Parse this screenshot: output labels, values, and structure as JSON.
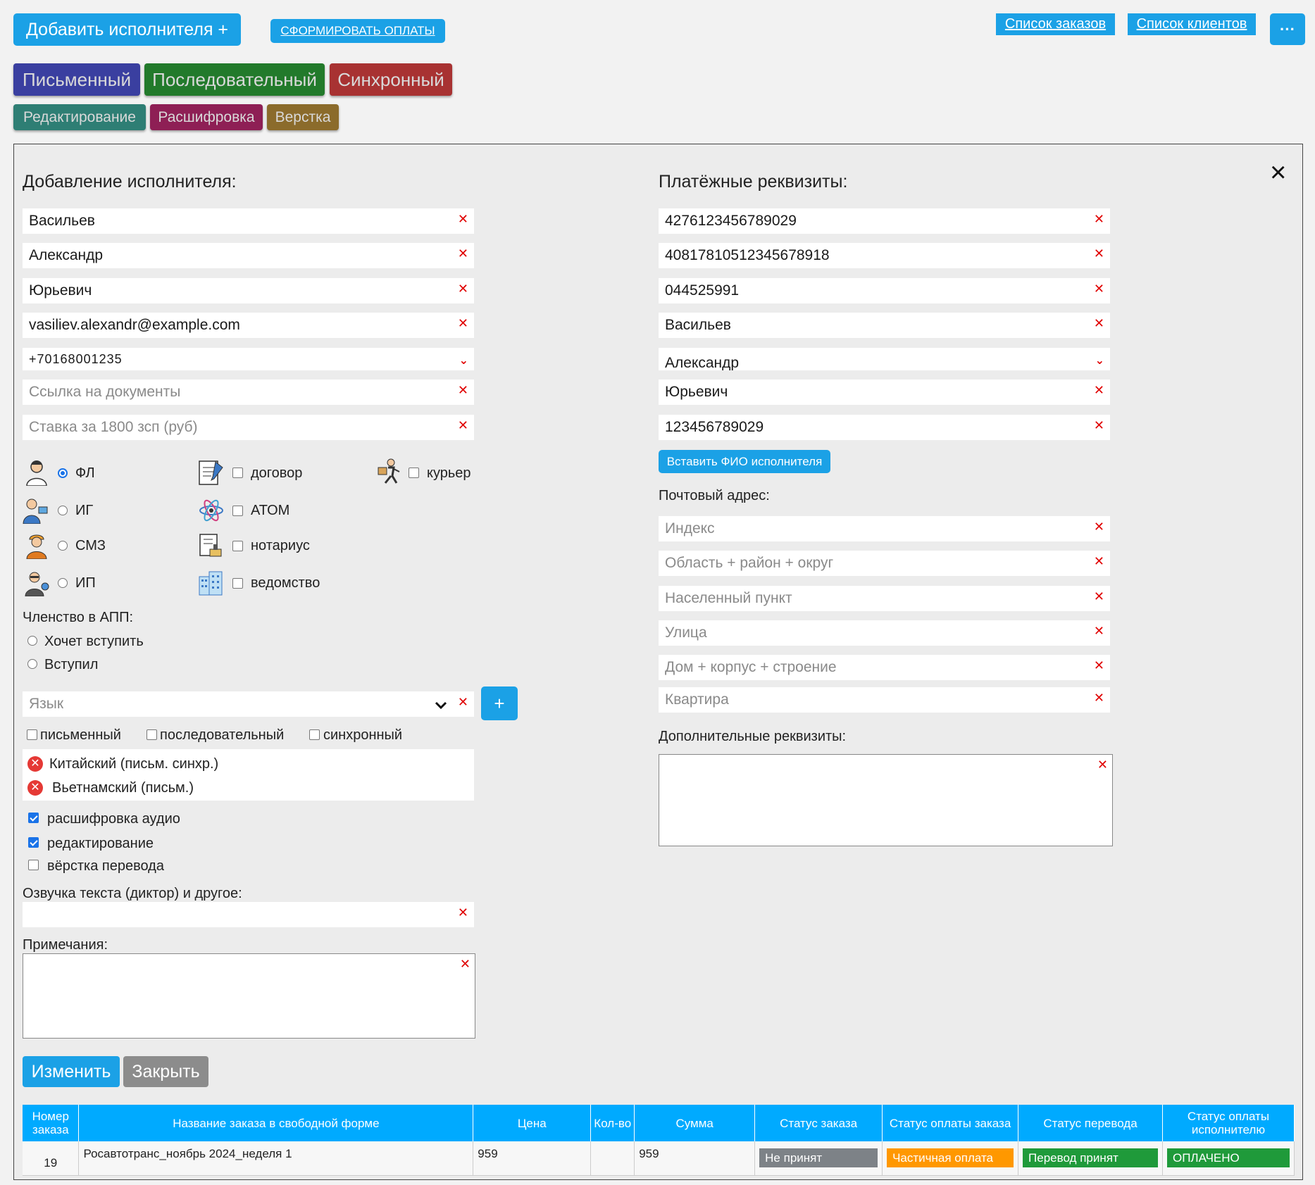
{
  "top": {
    "add_performer": "Добавить исполнителя +",
    "form_payments": "СФОРМИРОВАТЬ ОПЛАТЫ",
    "orders_list": "Список заказов",
    "clients_list": "Список клиентов",
    "more": "···"
  },
  "type_buttons": [
    {
      "label": "Письменный",
      "color": "#3a3fa0"
    },
    {
      "label": "Последовательный",
      "color": "#227a2b"
    },
    {
      "label": "Синхронный",
      "color": "#a83232"
    }
  ],
  "sub_buttons": [
    {
      "label": "Редактирование",
      "color": "#2e7e74"
    },
    {
      "label": "Расшифровка",
      "color": "#8e1f55"
    },
    {
      "label": "Верстка",
      "color": "#8b6b2b"
    }
  ],
  "left": {
    "heading": "Добавление исполнителя:",
    "fields": [
      {
        "value": "Васильев",
        "placeholder": ""
      },
      {
        "value": "Александр",
        "placeholder": ""
      },
      {
        "value": "Юрьевич",
        "placeholder": ""
      },
      {
        "value": "vasiliev.alexandr@example.com",
        "placeholder": ""
      },
      {
        "value": "+70168001235",
        "placeholder": ""
      },
      {
        "value": "",
        "placeholder": "Ссылка на документы"
      },
      {
        "value": "",
        "placeholder": "Ставка за 1800 зсп (руб)"
      }
    ],
    "status_radios": [
      "ФЛ",
      "ИГ",
      "СМЗ",
      "ИП"
    ],
    "doc_checks": [
      "договор",
      "АТОМ",
      "нотариус",
      "ведомство"
    ],
    "courier": "курьер",
    "app_label": "Членство в АПП:",
    "app_options": [
      "Хочет вступить",
      "Вступил"
    ],
    "language_placeholder": "Язык",
    "add_lang": "+",
    "mode_checks": [
      "письменный",
      "последовательный",
      "синхронный"
    ],
    "languages": [
      "Китайский (письм. синхр.)",
      "Вьетнамский (письм.)"
    ],
    "service_checks": [
      {
        "label": "расшифровка аудио",
        "checked": true
      },
      {
        "label": "редактирование",
        "checked": true
      },
      {
        "label": "вёрстка перевода",
        "checked": false
      }
    ],
    "voice_label": "Озвучка текста (диктор) и другое:",
    "notes_label": "Примечания:",
    "save": "Изменить",
    "close": "Закрыть"
  },
  "right": {
    "heading": "Платёжные реквизиты:",
    "fields": [
      {
        "value": "4276123456789029",
        "placeholder": ""
      },
      {
        "value": "40817810512345678918",
        "placeholder": ""
      },
      {
        "value": "044525991",
        "placeholder": ""
      },
      {
        "value": "Васильев",
        "placeholder": ""
      },
      {
        "value": "Александр",
        "placeholder": ""
      },
      {
        "value": "Юрьевич",
        "placeholder": ""
      },
      {
        "value": "123456789029",
        "placeholder": ""
      }
    ],
    "insert_fio": "Вставить ФИО исполнителя",
    "postal_label": "Почтовый адрес:",
    "postal_fields": [
      "Индекс",
      "Область + район + округ",
      "Населенный пункт",
      "Улица",
      "Дом + корпус + строение",
      "Квартира"
    ],
    "extra_label": "Дополнительные реквизиты:"
  },
  "close_icon": "×",
  "table": {
    "headers": [
      "Номер заказа",
      "Название заказа в свободной форме",
      "Цена",
      "Кол-во",
      "Сумма",
      "Статус заказа",
      "Статус оплаты заказа",
      "Статус перевода",
      "Статус оплаты исполнителю"
    ],
    "rows": [
      {
        "num": "19",
        "name": "Росавтотранс_ноябрь 2024_неделя 1",
        "price": "959",
        "qty": "",
        "sum": "959",
        "status": "Не принят",
        "pay_status": "Частичная оплата",
        "trans_status": "Перевод принят",
        "perf_pay": "ОПЛАЧЕНО"
      }
    ],
    "badge_colors": {
      "status": "#7d8287",
      "pay_status": "#ff9800",
      "trans_status": "#1f9a3a",
      "perf_pay": "#1f9a3a"
    }
  },
  "icons": {
    "person": "person-icon",
    "businessman": "businessman-icon",
    "worker": "worker-icon",
    "entrepreneur": "entrepreneur-icon",
    "contract": "contract-icon",
    "atom": "atom-icon",
    "notary": "notary-icon",
    "building": "building-icon",
    "courier": "courier-icon"
  }
}
